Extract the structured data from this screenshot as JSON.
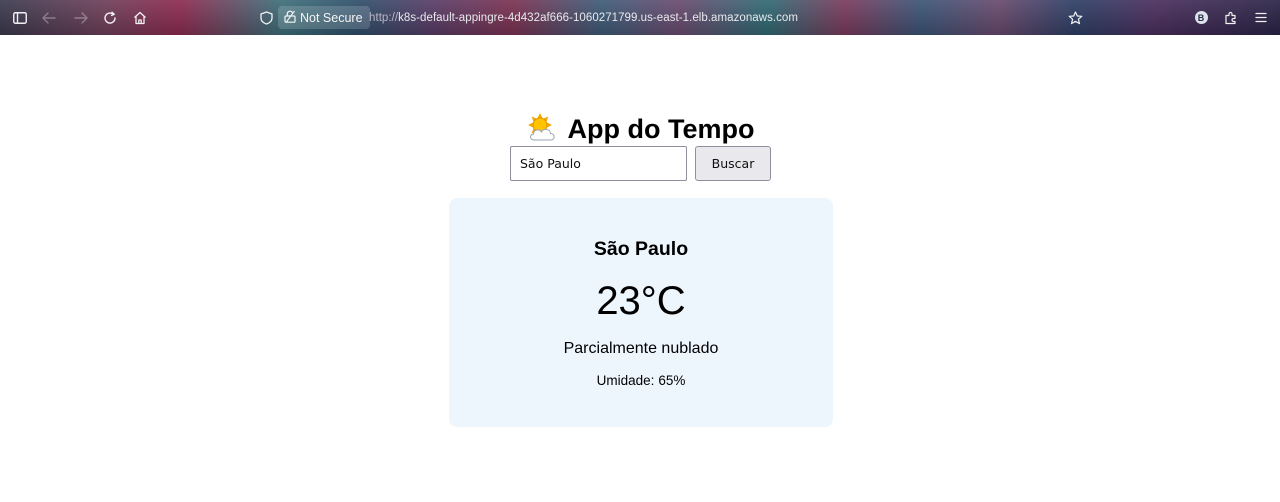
{
  "browser": {
    "site_info_label": "Not Secure",
    "url_scheme": "http://",
    "url_host": "k8s-default-appingre-4d432af666-1060271799.us-east-1.elb.amazonaws.com",
    "account_initial": "B",
    "icons": {
      "sidebar": "sidebar-toggle-icon",
      "back": "back-arrow-icon",
      "forward": "forward-arrow-icon",
      "reload": "reload-icon",
      "home": "home-icon",
      "tracking": "shield-icon",
      "lock": "broken-lock-icon",
      "bookmark": "star-icon",
      "extensions": "puzzle-icon",
      "menu": "hamburger-menu-icon"
    }
  },
  "app": {
    "title": "App do Tempo",
    "title_icon": "sun-behind-cloud-icon",
    "search": {
      "value": "São Paulo",
      "button_label": "Buscar"
    },
    "weather": {
      "city": "São Paulo",
      "temperature": "23°C",
      "description": "Parcialmente nublado",
      "humidity_label": "Umidade:",
      "humidity_value": "65%"
    },
    "colors": {
      "card_background": "#eef6fd",
      "button_background": "#e9e9ed"
    }
  }
}
